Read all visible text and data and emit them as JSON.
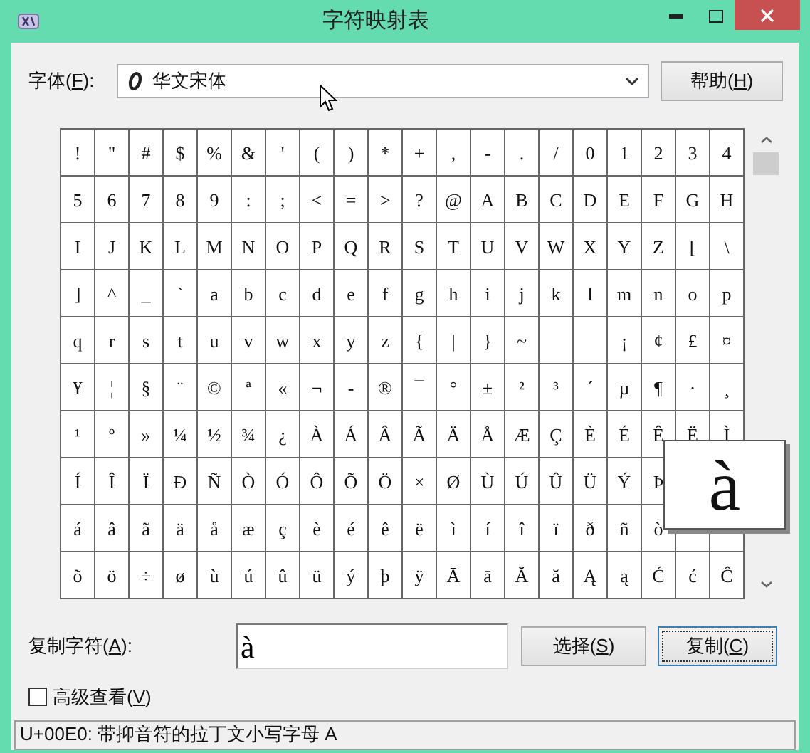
{
  "window": {
    "title": "字符映射表"
  },
  "font": {
    "label": {
      "before": "字体(",
      "mnemonic": "F",
      "after": "):"
    },
    "value": "华文宋体"
  },
  "help_button": {
    "before": "帮助(",
    "mnemonic": "H",
    "after": ")"
  },
  "grid": {
    "rows": [
      [
        "!",
        "\"",
        "#",
        "$",
        "%",
        "&",
        "'",
        "(",
        ")",
        "*",
        "+",
        ",",
        "-",
        ".",
        "/",
        "0",
        "1",
        "2",
        "3",
        "4"
      ],
      [
        "5",
        "6",
        "7",
        "8",
        "9",
        ":",
        ";",
        "<",
        "=",
        ">",
        "?",
        "@",
        "A",
        "B",
        "C",
        "D",
        "E",
        "F",
        "G",
        "H"
      ],
      [
        "I",
        "J",
        "K",
        "L",
        "M",
        "N",
        "O",
        "P",
        "Q",
        "R",
        "S",
        "T",
        "U",
        "V",
        "W",
        "X",
        "Y",
        "Z",
        "[",
        "\\"
      ],
      [
        "]",
        "^",
        "_",
        "`",
        "a",
        "b",
        "c",
        "d",
        "e",
        "f",
        "g",
        "h",
        "i",
        "j",
        "k",
        "l",
        "m",
        "n",
        "o",
        "p"
      ],
      [
        "q",
        "r",
        "s",
        "t",
        "u",
        "v",
        "w",
        "x",
        "y",
        "z",
        "{",
        "|",
        "}",
        "~",
        null,
        null,
        "¡",
        "¢",
        "£",
        "¤"
      ],
      [
        "¥",
        "¦",
        "§",
        "¨",
        "©",
        "ª",
        "«",
        "¬",
        "-",
        "®",
        "¯",
        "°",
        "±",
        "²",
        "³",
        "´",
        "µ",
        "¶",
        "·",
        "¸"
      ],
      [
        "¹",
        "º",
        "»",
        "¼",
        "½",
        "¾",
        "¿",
        "À",
        "Á",
        "Â",
        "Ã",
        "Ä",
        "Å",
        "Æ",
        "Ç",
        "È",
        "É",
        "Ê",
        "Ë",
        "Ì"
      ],
      [
        "Í",
        "Î",
        "Ï",
        "Ð",
        "Ñ",
        "Ò",
        "Ó",
        "Ô",
        "Õ",
        "Ö",
        "×",
        "Ø",
        "Ù",
        "Ú",
        "Û",
        "Ü",
        "Ý",
        "Þ"
      ],
      [
        "á",
        "â",
        "ã",
        "ä",
        "å",
        "æ",
        "ç",
        "è",
        "é",
        "ê",
        "ë",
        "ì",
        "í",
        "î",
        "ï",
        "ð",
        "ñ",
        "ò",
        null,
        null
      ],
      [
        "õ",
        "ö",
        "÷",
        "ø",
        "ù",
        "ú",
        "û",
        "ü",
        "ý",
        "þ",
        "ÿ",
        "Ā",
        "ā",
        "Ă",
        "ă",
        "Ą",
        "ą",
        "Ć",
        "ć",
        "Ĉ"
      ]
    ]
  },
  "magnified": "à",
  "copy": {
    "label": {
      "before": "复制字符(",
      "mnemonic": "A",
      "after": "):"
    },
    "value": "à"
  },
  "select_button": {
    "before": "选择(",
    "mnemonic": "S",
    "after": ")",
    "focused": false
  },
  "copy_button": {
    "before": "复制(",
    "mnemonic": "C",
    "after": ")",
    "focused": true
  },
  "advanced_view": {
    "label": {
      "before": "高级查看(",
      "mnemonic": "V",
      "after": ")"
    },
    "checked": false
  },
  "status_bar": "U+00E0: 带抑音符的拉丁文小写字母 A"
}
